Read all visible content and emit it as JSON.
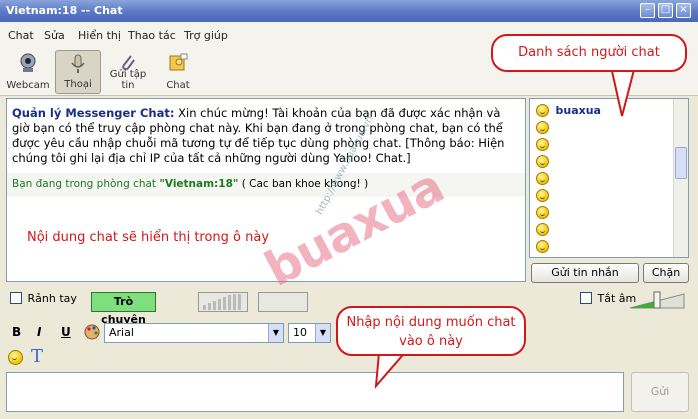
{
  "window": {
    "title": "Vietnam:18 -- Chat"
  },
  "menu": {
    "items": [
      "Chat",
      "Sửa",
      "Hiển thị",
      "Thao tác",
      "Trợ giúp"
    ]
  },
  "toolbar": {
    "webcam": "Webcam",
    "voice": "Thoại",
    "send_file": "Gửi tập tin",
    "chat": "Chat"
  },
  "chat": {
    "sender": "Quản lý Messenger Chat:",
    "message": "Xin chúc mừng! Tài khoản của bạn đã được xác nhận và giờ bạn có thể truy cập phòng chat này. Khi bạn đang ở trong phòng chat, bạn có thể được yêu cầu nhập chuỗi mã tương tự để tiếp tục dùng phòng chat. [Thông báo: Hiện chúng tôi ghi lại địa chỉ IP của tất cả những người dùng Yahoo! Chat.]",
    "status_prefix": "Bạn đang trong phòng chat",
    "room": "\"Vietnam:18\"",
    "room_topic": "( Cac ban khoe khong! )",
    "annotation": "Nội dung chat sẽ hiển thị trong ô này"
  },
  "watermark": {
    "brand": "buaxua",
    "url": "http://www.buaxua.vn"
  },
  "users": {
    "first": "buaxua",
    "others_count": 8
  },
  "buttons": {
    "send_im": "Gửi tin nhắn",
    "block": "Chặn",
    "send": "Gửi",
    "talk": "Trò chuyện"
  },
  "controls": {
    "handsfree": "Rảnh tay",
    "mute": "Tắt âm"
  },
  "format": {
    "bold": "B",
    "italic": "I",
    "underline": "U",
    "font": "Arial",
    "size": "10",
    "text_tool": "T"
  },
  "callouts": {
    "user_list": "Danh sách người chat",
    "input": "Nhập nội dung muốn chat vào ô này"
  }
}
